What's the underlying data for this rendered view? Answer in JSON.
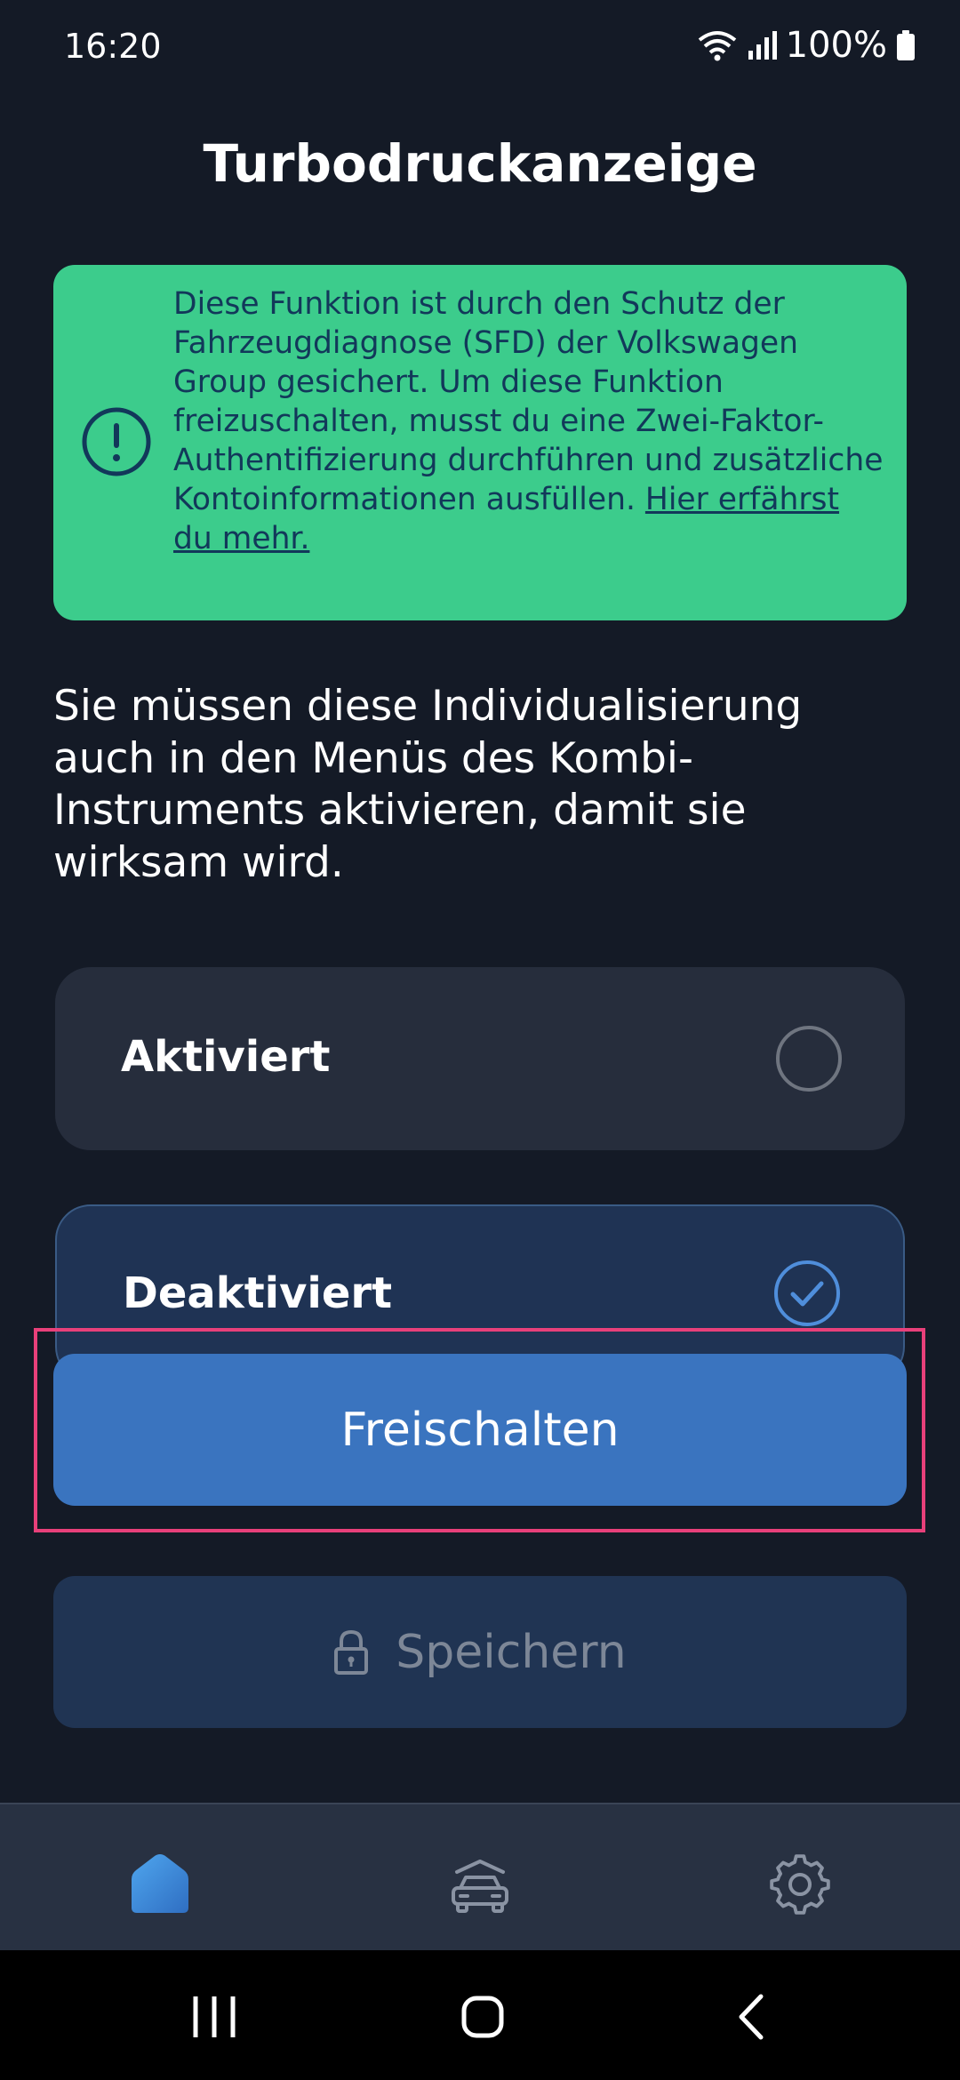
{
  "status_bar": {
    "time": "16:20",
    "battery": "100%",
    "icons": [
      "wifi-icon",
      "signal-icon",
      "battery-icon"
    ]
  },
  "page": {
    "title": "Turbodruckanzeige"
  },
  "notice": {
    "icon": "exclamation-circle-icon",
    "text": "Diese Funktion ist durch den Schutz der Fahrzeugdiagnose (SFD) der Volkswagen Group gesichert. Um diese Funktion freizuschalten, musst du eine Zwei-Faktor-Authentifizierung durchführen und zusätzliche Kontoinformationen ausfüllen.",
    "link_text": "Hier erfährst du mehr.",
    "background": "#3ccc8c",
    "text_color": "#12385a"
  },
  "info_text": "Sie müssen diese Individualisierung auch in den Menüs des Kombi-Instruments aktivieren, damit sie wirksam wird.",
  "options": [
    {
      "label": "Aktiviert",
      "selected": false
    },
    {
      "label": "Deaktiviert",
      "selected": true
    }
  ],
  "buttons": {
    "unlock_label": "Freischalten",
    "save_label": "Speichern",
    "save_icon": "lock-icon",
    "accent": "#3a74bf",
    "highlight": "#e8407a"
  },
  "bottom_nav": {
    "items": [
      {
        "icon": "home-icon",
        "active": true
      },
      {
        "icon": "car-icon",
        "active": false
      },
      {
        "icon": "gear-icon",
        "active": false
      }
    ]
  },
  "system_nav": {
    "items": [
      "recents-icon",
      "home-circle-icon",
      "back-icon"
    ]
  }
}
